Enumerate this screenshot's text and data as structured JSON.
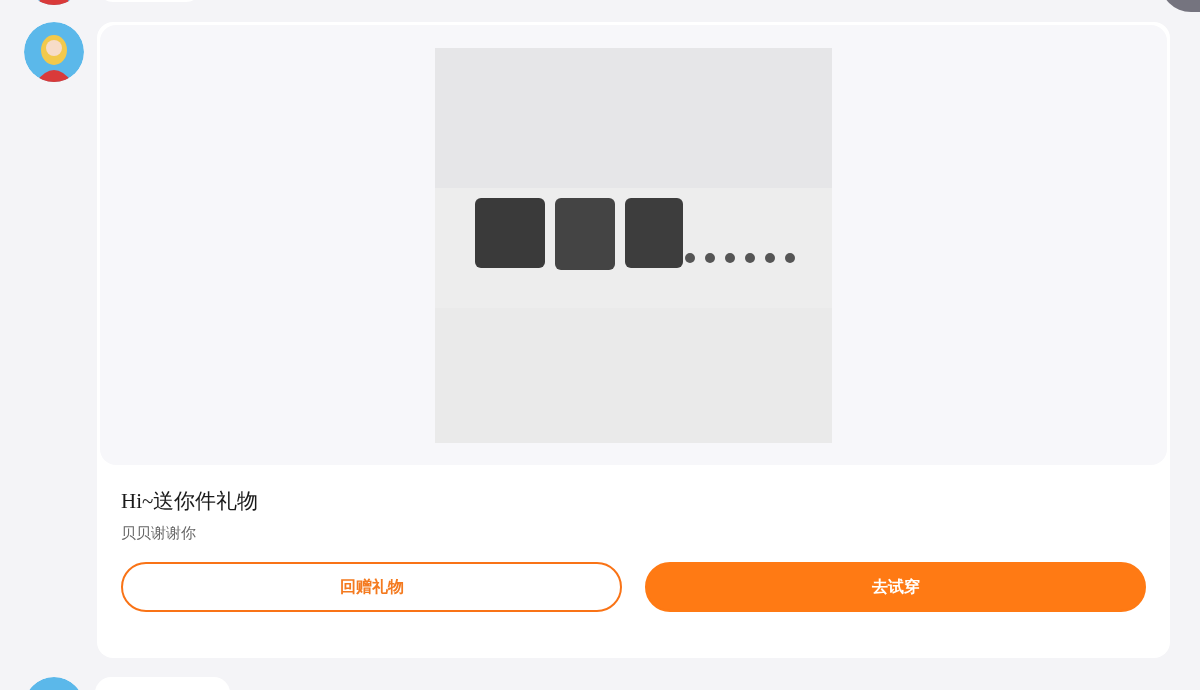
{
  "gift_card": {
    "title": "Hi~送你件礼物",
    "subtitle": "贝贝谢谢你",
    "buttons": [
      {
        "kind": "outline",
        "label": "回赠礼物"
      },
      {
        "kind": "filled",
        "label": "去试穿"
      }
    ]
  }
}
